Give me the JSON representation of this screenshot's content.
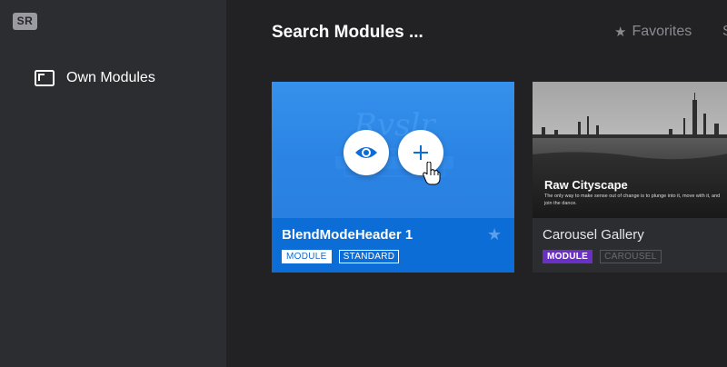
{
  "sidebar": {
    "logo": "SR",
    "items": [
      {
        "label": "Own Modules",
        "icon": "image-frame-icon"
      }
    ]
  },
  "header": {
    "search_title": "Search Modules ...",
    "tabs": [
      {
        "label": "Favorites",
        "icon": "star-icon"
      },
      {
        "label": "S"
      }
    ]
  },
  "cards": [
    {
      "title": "BlendModeHeader 1",
      "tags": [
        "MODULE",
        "STANDARD"
      ],
      "actions": [
        "eye-icon",
        "plus-icon"
      ],
      "favorite_icon": "star-icon",
      "accent": "#0d6dd6"
    },
    {
      "title": "Carousel Gallery",
      "tags": [
        "MODULE",
        "CAROUSEL"
      ],
      "thumb_title": "Raw Cityscape",
      "thumb_text": "The only way to make sense out of change is to plunge into it, move with it, and join the dance.",
      "module_tag_color": "#6a2fc5"
    }
  ],
  "colors": {
    "sidebar_bg": "#2c2d30",
    "main_bg": "#222225",
    "card_blue": "#0d6dd6"
  }
}
